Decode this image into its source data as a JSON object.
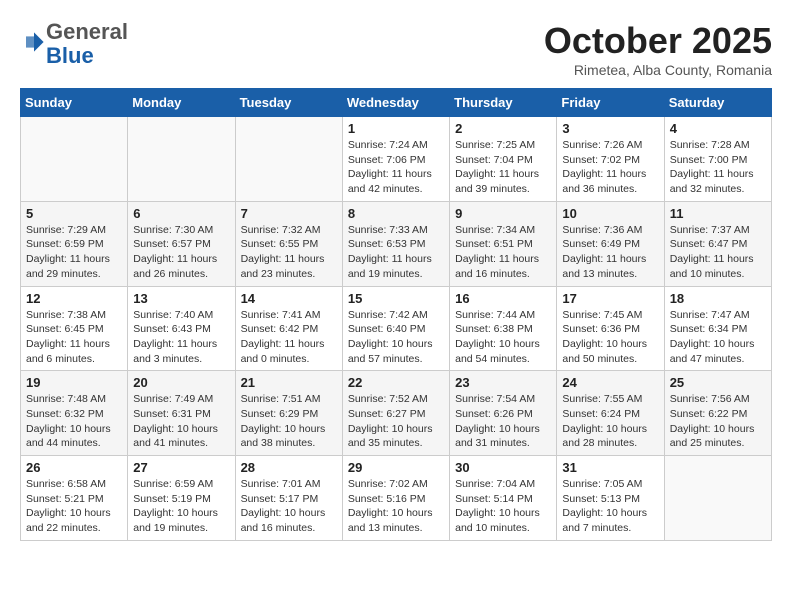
{
  "header": {
    "logo": {
      "general": "General",
      "blue": "Blue",
      "icon": "▶"
    },
    "title": "October 2025",
    "subtitle": "Rimetea, Alba County, Romania"
  },
  "calendar": {
    "weekdays": [
      "Sunday",
      "Monday",
      "Tuesday",
      "Wednesday",
      "Thursday",
      "Friday",
      "Saturday"
    ],
    "weeks": [
      [
        {
          "day": "",
          "info": ""
        },
        {
          "day": "",
          "info": ""
        },
        {
          "day": "",
          "info": ""
        },
        {
          "day": "1",
          "info": "Sunrise: 7:24 AM\nSunset: 7:06 PM\nDaylight: 11 hours and 42 minutes."
        },
        {
          "day": "2",
          "info": "Sunrise: 7:25 AM\nSunset: 7:04 PM\nDaylight: 11 hours and 39 minutes."
        },
        {
          "day": "3",
          "info": "Sunrise: 7:26 AM\nSunset: 7:02 PM\nDaylight: 11 hours and 36 minutes."
        },
        {
          "day": "4",
          "info": "Sunrise: 7:28 AM\nSunset: 7:00 PM\nDaylight: 11 hours and 32 minutes."
        }
      ],
      [
        {
          "day": "5",
          "info": "Sunrise: 7:29 AM\nSunset: 6:59 PM\nDaylight: 11 hours and 29 minutes."
        },
        {
          "day": "6",
          "info": "Sunrise: 7:30 AM\nSunset: 6:57 PM\nDaylight: 11 hours and 26 minutes."
        },
        {
          "day": "7",
          "info": "Sunrise: 7:32 AM\nSunset: 6:55 PM\nDaylight: 11 hours and 23 minutes."
        },
        {
          "day": "8",
          "info": "Sunrise: 7:33 AM\nSunset: 6:53 PM\nDaylight: 11 hours and 19 minutes."
        },
        {
          "day": "9",
          "info": "Sunrise: 7:34 AM\nSunset: 6:51 PM\nDaylight: 11 hours and 16 minutes."
        },
        {
          "day": "10",
          "info": "Sunrise: 7:36 AM\nSunset: 6:49 PM\nDaylight: 11 hours and 13 minutes."
        },
        {
          "day": "11",
          "info": "Sunrise: 7:37 AM\nSunset: 6:47 PM\nDaylight: 11 hours and 10 minutes."
        }
      ],
      [
        {
          "day": "12",
          "info": "Sunrise: 7:38 AM\nSunset: 6:45 PM\nDaylight: 11 hours and 6 minutes."
        },
        {
          "day": "13",
          "info": "Sunrise: 7:40 AM\nSunset: 6:43 PM\nDaylight: 11 hours and 3 minutes."
        },
        {
          "day": "14",
          "info": "Sunrise: 7:41 AM\nSunset: 6:42 PM\nDaylight: 11 hours and 0 minutes."
        },
        {
          "day": "15",
          "info": "Sunrise: 7:42 AM\nSunset: 6:40 PM\nDaylight: 10 hours and 57 minutes."
        },
        {
          "day": "16",
          "info": "Sunrise: 7:44 AM\nSunset: 6:38 PM\nDaylight: 10 hours and 54 minutes."
        },
        {
          "day": "17",
          "info": "Sunrise: 7:45 AM\nSunset: 6:36 PM\nDaylight: 10 hours and 50 minutes."
        },
        {
          "day": "18",
          "info": "Sunrise: 7:47 AM\nSunset: 6:34 PM\nDaylight: 10 hours and 47 minutes."
        }
      ],
      [
        {
          "day": "19",
          "info": "Sunrise: 7:48 AM\nSunset: 6:32 PM\nDaylight: 10 hours and 44 minutes."
        },
        {
          "day": "20",
          "info": "Sunrise: 7:49 AM\nSunset: 6:31 PM\nDaylight: 10 hours and 41 minutes."
        },
        {
          "day": "21",
          "info": "Sunrise: 7:51 AM\nSunset: 6:29 PM\nDaylight: 10 hours and 38 minutes."
        },
        {
          "day": "22",
          "info": "Sunrise: 7:52 AM\nSunset: 6:27 PM\nDaylight: 10 hours and 35 minutes."
        },
        {
          "day": "23",
          "info": "Sunrise: 7:54 AM\nSunset: 6:26 PM\nDaylight: 10 hours and 31 minutes."
        },
        {
          "day": "24",
          "info": "Sunrise: 7:55 AM\nSunset: 6:24 PM\nDaylight: 10 hours and 28 minutes."
        },
        {
          "day": "25",
          "info": "Sunrise: 7:56 AM\nSunset: 6:22 PM\nDaylight: 10 hours and 25 minutes."
        }
      ],
      [
        {
          "day": "26",
          "info": "Sunrise: 6:58 AM\nSunset: 5:21 PM\nDaylight: 10 hours and 22 minutes."
        },
        {
          "day": "27",
          "info": "Sunrise: 6:59 AM\nSunset: 5:19 PM\nDaylight: 10 hours and 19 minutes."
        },
        {
          "day": "28",
          "info": "Sunrise: 7:01 AM\nSunset: 5:17 PM\nDaylight: 10 hours and 16 minutes."
        },
        {
          "day": "29",
          "info": "Sunrise: 7:02 AM\nSunset: 5:16 PM\nDaylight: 10 hours and 13 minutes."
        },
        {
          "day": "30",
          "info": "Sunrise: 7:04 AM\nSunset: 5:14 PM\nDaylight: 10 hours and 10 minutes."
        },
        {
          "day": "31",
          "info": "Sunrise: 7:05 AM\nSunset: 5:13 PM\nDaylight: 10 hours and 7 minutes."
        },
        {
          "day": "",
          "info": ""
        }
      ]
    ]
  }
}
